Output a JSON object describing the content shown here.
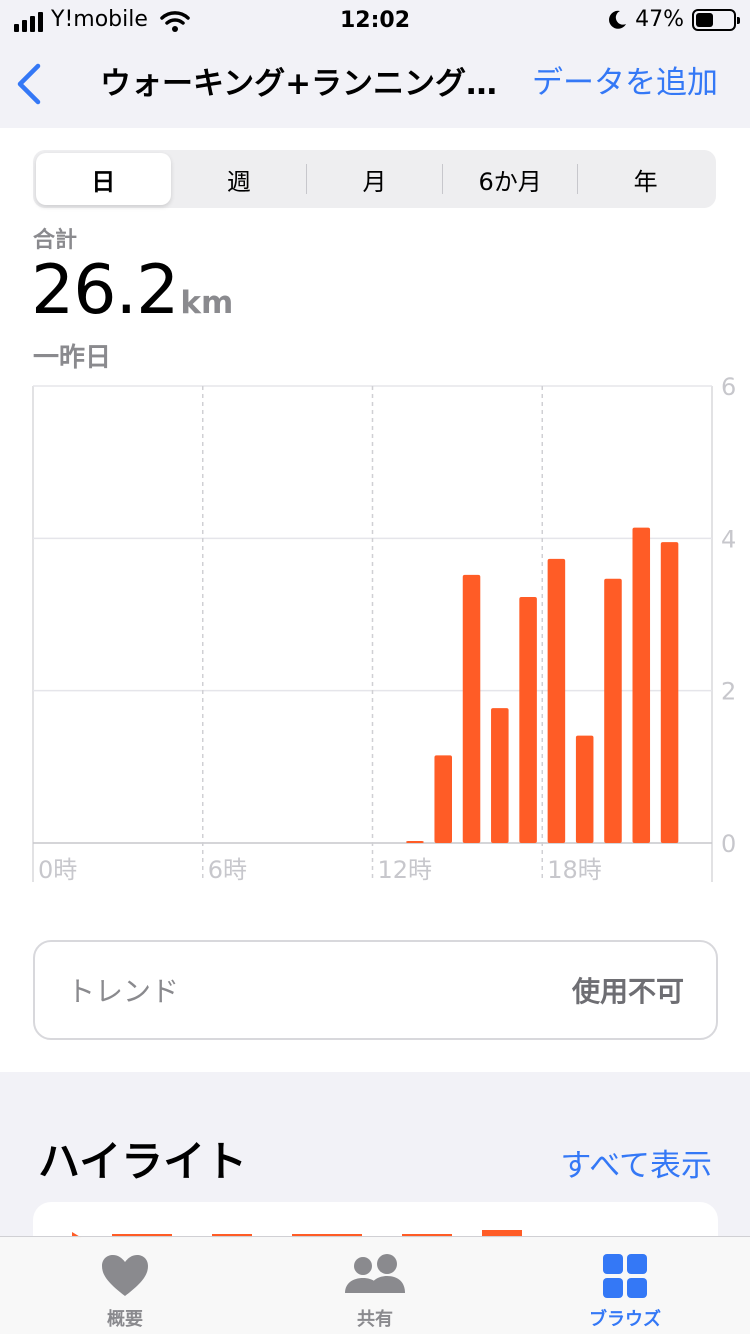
{
  "status_bar": {
    "carrier": "Y!mobile",
    "time": "12:02",
    "battery": "47%",
    "battery_level": 0.47
  },
  "nav": {
    "title": "ウォーキング+ランニング…",
    "add_label": "データを追加"
  },
  "segments": [
    {
      "label": "日",
      "active": true
    },
    {
      "label": "週",
      "active": false
    },
    {
      "label": "月",
      "active": false
    },
    {
      "label": "6か月",
      "active": false
    },
    {
      "label": "年",
      "active": false
    }
  ],
  "summary": {
    "label": "合計",
    "value": "26.2",
    "unit": "km",
    "date": "一昨日"
  },
  "chart_data": {
    "type": "bar",
    "x_tick_labels": [
      "0時",
      "6時",
      "12時",
      "18時"
    ],
    "y_tick_labels": [
      "0",
      "2",
      "4",
      "6"
    ],
    "ylim": [
      0,
      6
    ],
    "x_range": [
      0,
      24
    ],
    "grid": true,
    "bar_color": "#ff5c26",
    "series": [
      {
        "hours": [
          13,
          14,
          15,
          16,
          17,
          18,
          19,
          20,
          21,
          22,
          23
        ],
        "values": [
          0.02,
          1.15,
          3.52,
          1.77,
          3.23,
          3.73,
          1.41,
          3.47,
          4.14,
          3.95,
          0
        ]
      }
    ]
  },
  "trend": {
    "label": "トレンド",
    "value": "使用不可"
  },
  "highlights": {
    "title": "ハイライト",
    "show_all": "すべて表示"
  },
  "tabs": [
    {
      "label": "概要",
      "icon": "heart-icon",
      "active": false
    },
    {
      "label": "共有",
      "icon": "people-icon",
      "active": false
    },
    {
      "label": "ブラウズ",
      "icon": "grid-icon",
      "active": true
    }
  ],
  "colors": {
    "accent": "#3478f6",
    "chart_bar": "#ff5c26",
    "secondary_text": "#8a8a8e"
  }
}
